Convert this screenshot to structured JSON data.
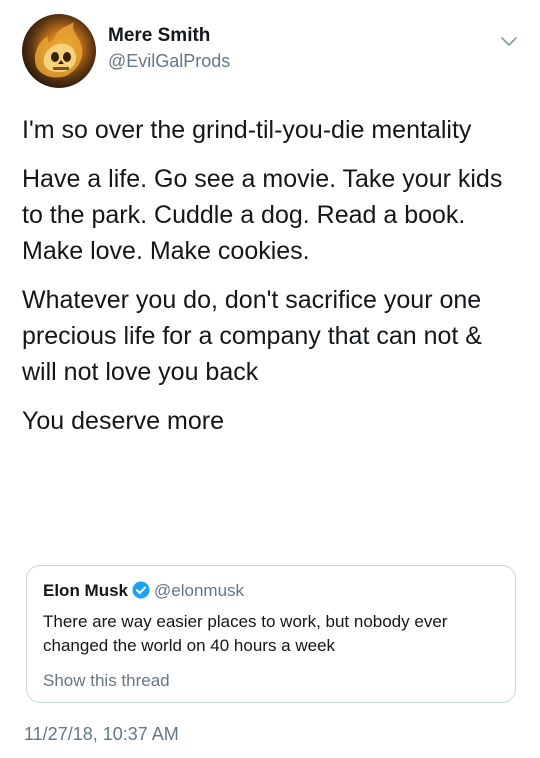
{
  "author": {
    "display_name": "Mere Smith",
    "handle": "@EvilGalProds",
    "avatar_icon": "flaming-skull-avatar"
  },
  "tweet": {
    "paragraphs": [
      "I'm so over the grind-til-you-die mentality",
      "Have a life. Go see a movie. Take your kids to the park. Cuddle a dog. Read a book. Make love. Make cookies.",
      "Whatever you do, don't sacrifice your one precious life for a company that can not & will not love you back",
      "You deserve more"
    ],
    "timestamp": "11/27/18, 10:37 AM"
  },
  "quoted_tweet": {
    "display_name": "Elon Musk",
    "handle": "@elonmusk",
    "verified": true,
    "text": "There are way easier places to work, but nobody ever changed the world on 40 hours a week",
    "show_thread_label": "Show this thread"
  },
  "colors": {
    "text_primary": "#14171a",
    "text_secondary": "#657786",
    "verified_blue": "#1da1f2",
    "border": "#ccd6dd"
  },
  "icons": {
    "menu": "chevron-down-icon",
    "verified": "verified-badge-icon"
  }
}
